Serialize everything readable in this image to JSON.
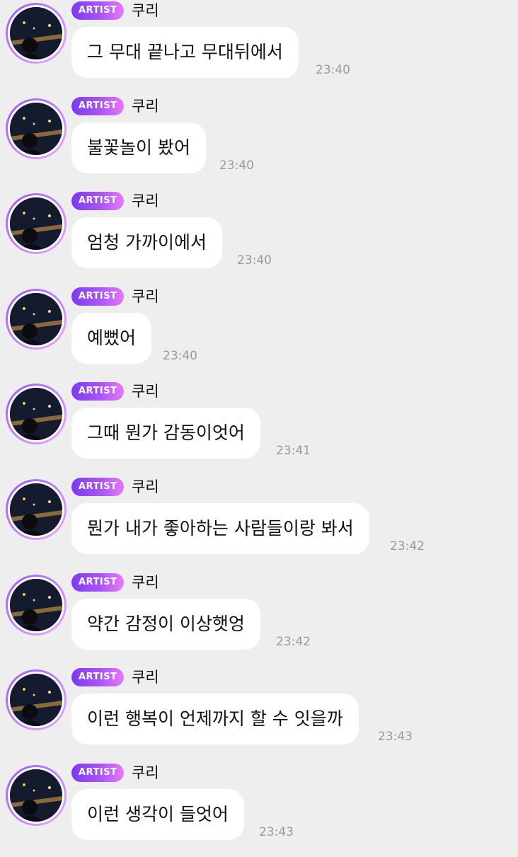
{
  "colors": {
    "background": "#eeeeee",
    "bubble": "#ffffff",
    "badge_gradient_start": "#7c3aed",
    "badge_gradient_end": "#e879f9",
    "timestamp": "#9a9a9a"
  },
  "messages": [
    {
      "badge": "ARTIST",
      "sender": "쿠리",
      "text": "그 무대 끝나고 무대뒤에서",
      "time": "23:40"
    },
    {
      "badge": "ARTIST",
      "sender": "쿠리",
      "text": "불꽃놀이 봤어",
      "time": "23:40"
    },
    {
      "badge": "ARTIST",
      "sender": "쿠리",
      "text": "엄청 가까이에서",
      "time": "23:40"
    },
    {
      "badge": "ARTIST",
      "sender": "쿠리",
      "text": "예뻤어",
      "time": "23:40"
    },
    {
      "badge": "ARTIST",
      "sender": "쿠리",
      "text": "그때 뭔가 감동이엇어",
      "time": "23:41"
    },
    {
      "badge": "ARTIST",
      "sender": "쿠리",
      "text": "뭔가 내가 좋아하는 사람들이랑 봐서",
      "time": "23:42"
    },
    {
      "badge": "ARTIST",
      "sender": "쿠리",
      "text": "약간 감정이 이상햇엉",
      "time": "23:42"
    },
    {
      "badge": "ARTIST",
      "sender": "쿠리",
      "text": "이런 행복이 언제까지 할 수 잇을까",
      "time": "23:43"
    },
    {
      "badge": "ARTIST",
      "sender": "쿠리",
      "text": "이런 생각이 들엇어",
      "time": "23:43"
    }
  ]
}
